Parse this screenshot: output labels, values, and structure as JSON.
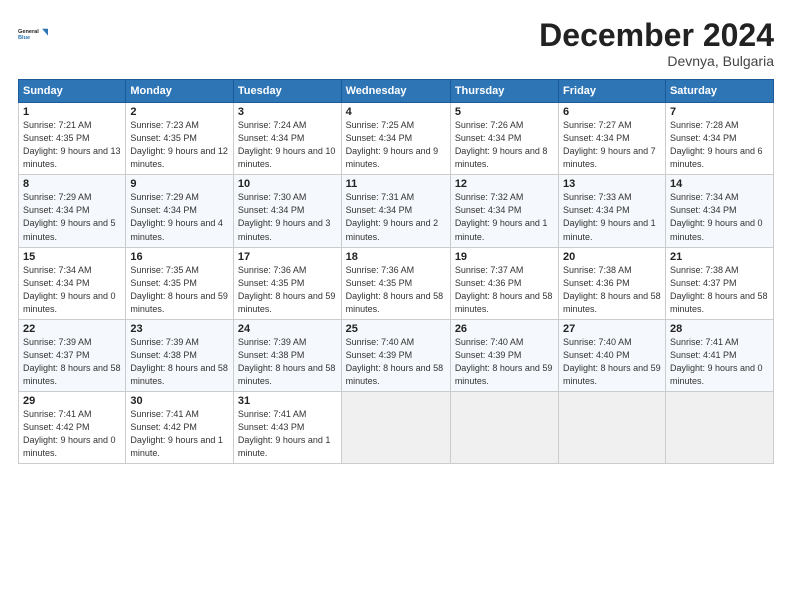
{
  "header": {
    "logo_line1": "General",
    "logo_line2": "Blue",
    "month": "December 2024",
    "location": "Devnya, Bulgaria"
  },
  "days_of_week": [
    "Sunday",
    "Monday",
    "Tuesday",
    "Wednesday",
    "Thursday",
    "Friday",
    "Saturday"
  ],
  "weeks": [
    [
      {
        "day": "1",
        "sunrise": "Sunrise: 7:21 AM",
        "sunset": "Sunset: 4:35 PM",
        "daylight": "Daylight: 9 hours and 13 minutes."
      },
      {
        "day": "2",
        "sunrise": "Sunrise: 7:23 AM",
        "sunset": "Sunset: 4:35 PM",
        "daylight": "Daylight: 9 hours and 12 minutes."
      },
      {
        "day": "3",
        "sunrise": "Sunrise: 7:24 AM",
        "sunset": "Sunset: 4:34 PM",
        "daylight": "Daylight: 9 hours and 10 minutes."
      },
      {
        "day": "4",
        "sunrise": "Sunrise: 7:25 AM",
        "sunset": "Sunset: 4:34 PM",
        "daylight": "Daylight: 9 hours and 9 minutes."
      },
      {
        "day": "5",
        "sunrise": "Sunrise: 7:26 AM",
        "sunset": "Sunset: 4:34 PM",
        "daylight": "Daylight: 9 hours and 8 minutes."
      },
      {
        "day": "6",
        "sunrise": "Sunrise: 7:27 AM",
        "sunset": "Sunset: 4:34 PM",
        "daylight": "Daylight: 9 hours and 7 minutes."
      },
      {
        "day": "7",
        "sunrise": "Sunrise: 7:28 AM",
        "sunset": "Sunset: 4:34 PM",
        "daylight": "Daylight: 9 hours and 6 minutes."
      }
    ],
    [
      {
        "day": "8",
        "sunrise": "Sunrise: 7:29 AM",
        "sunset": "Sunset: 4:34 PM",
        "daylight": "Daylight: 9 hours and 5 minutes."
      },
      {
        "day": "9",
        "sunrise": "Sunrise: 7:29 AM",
        "sunset": "Sunset: 4:34 PM",
        "daylight": "Daylight: 9 hours and 4 minutes."
      },
      {
        "day": "10",
        "sunrise": "Sunrise: 7:30 AM",
        "sunset": "Sunset: 4:34 PM",
        "daylight": "Daylight: 9 hours and 3 minutes."
      },
      {
        "day": "11",
        "sunrise": "Sunrise: 7:31 AM",
        "sunset": "Sunset: 4:34 PM",
        "daylight": "Daylight: 9 hours and 2 minutes."
      },
      {
        "day": "12",
        "sunrise": "Sunrise: 7:32 AM",
        "sunset": "Sunset: 4:34 PM",
        "daylight": "Daylight: 9 hours and 1 minute."
      },
      {
        "day": "13",
        "sunrise": "Sunrise: 7:33 AM",
        "sunset": "Sunset: 4:34 PM",
        "daylight": "Daylight: 9 hours and 1 minute."
      },
      {
        "day": "14",
        "sunrise": "Sunrise: 7:34 AM",
        "sunset": "Sunset: 4:34 PM",
        "daylight": "Daylight: 9 hours and 0 minutes."
      }
    ],
    [
      {
        "day": "15",
        "sunrise": "Sunrise: 7:34 AM",
        "sunset": "Sunset: 4:34 PM",
        "daylight": "Daylight: 9 hours and 0 minutes."
      },
      {
        "day": "16",
        "sunrise": "Sunrise: 7:35 AM",
        "sunset": "Sunset: 4:35 PM",
        "daylight": "Daylight: 8 hours and 59 minutes."
      },
      {
        "day": "17",
        "sunrise": "Sunrise: 7:36 AM",
        "sunset": "Sunset: 4:35 PM",
        "daylight": "Daylight: 8 hours and 59 minutes."
      },
      {
        "day": "18",
        "sunrise": "Sunrise: 7:36 AM",
        "sunset": "Sunset: 4:35 PM",
        "daylight": "Daylight: 8 hours and 58 minutes."
      },
      {
        "day": "19",
        "sunrise": "Sunrise: 7:37 AM",
        "sunset": "Sunset: 4:36 PM",
        "daylight": "Daylight: 8 hours and 58 minutes."
      },
      {
        "day": "20",
        "sunrise": "Sunrise: 7:38 AM",
        "sunset": "Sunset: 4:36 PM",
        "daylight": "Daylight: 8 hours and 58 minutes."
      },
      {
        "day": "21",
        "sunrise": "Sunrise: 7:38 AM",
        "sunset": "Sunset: 4:37 PM",
        "daylight": "Daylight: 8 hours and 58 minutes."
      }
    ],
    [
      {
        "day": "22",
        "sunrise": "Sunrise: 7:39 AM",
        "sunset": "Sunset: 4:37 PM",
        "daylight": "Daylight: 8 hours and 58 minutes."
      },
      {
        "day": "23",
        "sunrise": "Sunrise: 7:39 AM",
        "sunset": "Sunset: 4:38 PM",
        "daylight": "Daylight: 8 hours and 58 minutes."
      },
      {
        "day": "24",
        "sunrise": "Sunrise: 7:39 AM",
        "sunset": "Sunset: 4:38 PM",
        "daylight": "Daylight: 8 hours and 58 minutes."
      },
      {
        "day": "25",
        "sunrise": "Sunrise: 7:40 AM",
        "sunset": "Sunset: 4:39 PM",
        "daylight": "Daylight: 8 hours and 58 minutes."
      },
      {
        "day": "26",
        "sunrise": "Sunrise: 7:40 AM",
        "sunset": "Sunset: 4:39 PM",
        "daylight": "Daylight: 8 hours and 59 minutes."
      },
      {
        "day": "27",
        "sunrise": "Sunrise: 7:40 AM",
        "sunset": "Sunset: 4:40 PM",
        "daylight": "Daylight: 8 hours and 59 minutes."
      },
      {
        "day": "28",
        "sunrise": "Sunrise: 7:41 AM",
        "sunset": "Sunset: 4:41 PM",
        "daylight": "Daylight: 9 hours and 0 minutes."
      }
    ],
    [
      {
        "day": "29",
        "sunrise": "Sunrise: 7:41 AM",
        "sunset": "Sunset: 4:42 PM",
        "daylight": "Daylight: 9 hours and 0 minutes."
      },
      {
        "day": "30",
        "sunrise": "Sunrise: 7:41 AM",
        "sunset": "Sunset: 4:42 PM",
        "daylight": "Daylight: 9 hours and 1 minute."
      },
      {
        "day": "31",
        "sunrise": "Sunrise: 7:41 AM",
        "sunset": "Sunset: 4:43 PM",
        "daylight": "Daylight: 9 hours and 1 minute."
      },
      null,
      null,
      null,
      null
    ]
  ]
}
